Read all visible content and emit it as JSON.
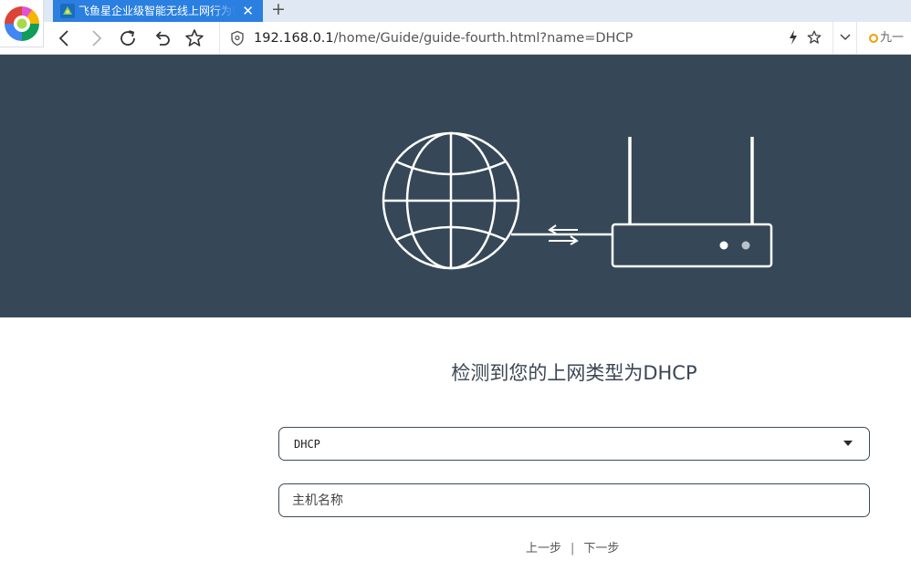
{
  "browser": {
    "tab": {
      "title": "飞鱼星企业级智能无线上网行为管理",
      "close_glyph": "✕"
    },
    "new_tab_glyph": "+",
    "address_bar": {
      "url_host": "192.168.0.1",
      "url_path": "/home/Guide/guide-fourth.html?name=DHCP"
    },
    "search_engine": {
      "label": "九一"
    },
    "icons": {
      "back": "back-arrow-icon",
      "forward": "forward-arrow-icon",
      "reload": "reload-icon",
      "undo": "undo-icon",
      "bookmark": "star-icon",
      "security": "shield-icon",
      "fast": "lightning-icon",
      "favorite": "star-outline-icon",
      "menu": "chevron-down-icon"
    }
  },
  "page": {
    "detect_title": "检测到您的上网类型为DHCP",
    "connection_select": {
      "value": "DHCP"
    },
    "hostname_input": {
      "placeholder": "主机名称",
      "value": ""
    },
    "nav": {
      "prev_label": "上一步",
      "separator": "|",
      "next_label": "下一步"
    }
  },
  "colors": {
    "hero_background": "#364857",
    "tab_active": "#2a7fe0",
    "tabstrip": "#dfe8f3",
    "field_border": "#3d4b57",
    "title_text": "#3b4654"
  }
}
